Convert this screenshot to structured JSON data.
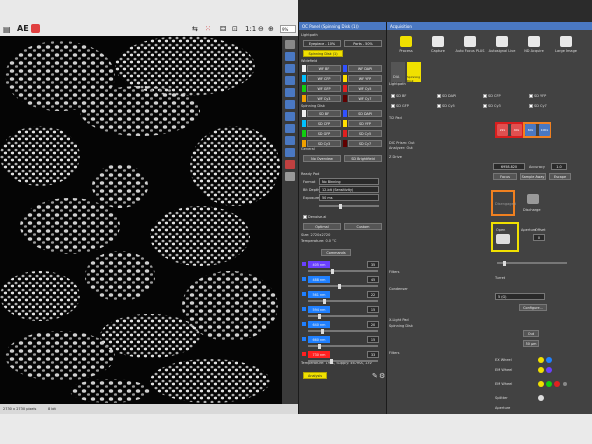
{
  "toolbar": {
    "ae_label": "AE",
    "zoom_label": "1:1",
    "zoom_percent": "9%"
  },
  "status": {
    "size": "2730 x 2730 pixels",
    "bits": "8 bit"
  },
  "oc_panel": {
    "title": "OC Panel (Spinning Disk (1))",
    "lightpath": "Lightpath",
    "eyepiece": "Eyepiece - 10%",
    "ports": "Ports - 50%",
    "spinning_disk_btn": "Spinning Disk (1)",
    "widefield_label": "Widefield",
    "widefield_rows": [
      {
        "left": "WF BF",
        "right": "WF DAPI",
        "lcolor": "#f0f0f0",
        "rcolor": "#3050ff"
      },
      {
        "left": "WF CFP",
        "right": "WF YFP",
        "lcolor": "#00c0ff",
        "rcolor": "#ffe000"
      },
      {
        "left": "WF GFP",
        "right": "WF Cy5",
        "lcolor": "#10d010",
        "rcolor": "#e02020"
      },
      {
        "left": "WF Cy3",
        "right": "WF Cy7",
        "lcolor": "#f0a000",
        "rcolor": "#600000"
      }
    ],
    "spinning_label": "Spinning Disk",
    "spinning_rows": [
      {
        "left": "SD BF",
        "right": "SD DAPI",
        "lcolor": "#f0f0f0",
        "rcolor": "#3050ff"
      },
      {
        "left": "SD CFP",
        "right": "SD YFP",
        "lcolor": "#00c0ff",
        "rcolor": "#ffe000"
      },
      {
        "left": "SD GFP",
        "right": "SD Cy5",
        "lcolor": "#10d010",
        "rcolor": "#e02020"
      },
      {
        "left": "SD Cy3",
        "right": "SD Cy7",
        "lcolor": "#f0a000",
        "rcolor": "#600000"
      }
    ],
    "general_label": "General",
    "no_overview": "No Overview",
    "sd_brightfield": "SD Brightfield",
    "plane": {
      "title": "Ready Pad",
      "format_label": "Format",
      "format_value": "No Binning",
      "bitdepth_label": "Bit Depth",
      "bitdepth_value": "12-bit (Sensitivity)",
      "exposure_label": "Exposure",
      "exposure_value": "50 ms"
    },
    "denoise": "Denoise.ai",
    "optimal": "Optimal",
    "custom": "Custom",
    "size_line": "Size: 2720x2720",
    "temp_line": "Temperature: 0.0 °C",
    "commands": "Commands",
    "lasers": [
      {
        "label": "405 nm",
        "value": "35",
        "color": "#6a40ff",
        "level": 0.35
      },
      {
        "label": "488 nm",
        "value": "45",
        "color": "#2080ff",
        "level": 0.45
      },
      {
        "label": "561 nm",
        "value": "22",
        "color": "#2080ff",
        "level": 0.22
      },
      {
        "label": "594 nm",
        "value": "15",
        "color": "#2080ff",
        "level": 0.15
      },
      {
        "label": "640 nm",
        "value": "20",
        "color": "#2080ff",
        "level": 0.2
      },
      {
        "label": "660 nm",
        "value": "15",
        "color": "#2080ff",
        "level": 0.15
      },
      {
        "label": "730 nm",
        "value": "33",
        "color": "#ff2020",
        "level": 0.33
      }
    ],
    "temps": "Temperature: 19°C, Supply: 467mA, 13V",
    "analysis": "Analysis"
  },
  "acquisition": {
    "title": "Acquisition",
    "buttons": [
      {
        "label": "Process",
        "icon": "pause-icon"
      },
      {
        "label": "Capture",
        "icon": "camera-icon"
      },
      {
        "label": "Auto Focus PLUS",
        "icon": "autofocus-icon"
      },
      {
        "label": "Autosignal Live",
        "icon": "autosignal-icon"
      },
      {
        "label": "ND Acquire",
        "icon": "nd-icon"
      },
      {
        "label": "Large Image",
        "icon": "large-image-icon"
      }
    ],
    "lightpath": "Lightpath",
    "dia": "DIA",
    "spinning": "Spinning Disk",
    "channels_row1": [
      "SD BF",
      "SD DAPI",
      "SD CFP",
      "SD YFP"
    ],
    "channels_row2": [
      "SD GFP",
      "SD Cy5",
      "SD Cy3",
      "SD Cy7"
    ],
    "ti_pad": "Ti2 Pad",
    "zoom_label": "Zoom",
    "zoom_value": "DIC Prism: Out",
    "analyzer": "Analyzer: Out",
    "zdrive_label": "Z Drive",
    "z_value": "6958.820",
    "accuracy_label": "Accuracy",
    "accuracy_value": "1.0",
    "focus_btn": "Focus",
    "sample_away": "Sample Away",
    "escape": "Escape",
    "disengaged": "Disengaged",
    "discharge": "Discharge",
    "open_label": "Open",
    "shutters": "Shutters",
    "condenser": "Condenser",
    "aperture_label": "Aperture",
    "offset_label": "Offset",
    "offset_value": "0",
    "filters": "Filters",
    "turret": "Turret",
    "turret_value": "5 (G)",
    "configure": "Configure...",
    "xlight": "X-Light Pad",
    "spinning_disk": "Spinning Disk",
    "out": "Out",
    "pinhole": "50 μm",
    "filters2": "Filters",
    "ex_wheel": "EX Wheel",
    "em_wheel": "EM Wheel",
    "em_wheel2": "EM Wheel",
    "splitter": "Splitter",
    "aperture_bottom": "Aperture",
    "camera_values": [
      "22x",
      "40x",
      "60x",
      "100x"
    ],
    "colors": {
      "red": "#d81e1e",
      "orange": "#f08020",
      "yellow": "#f0e000"
    }
  }
}
